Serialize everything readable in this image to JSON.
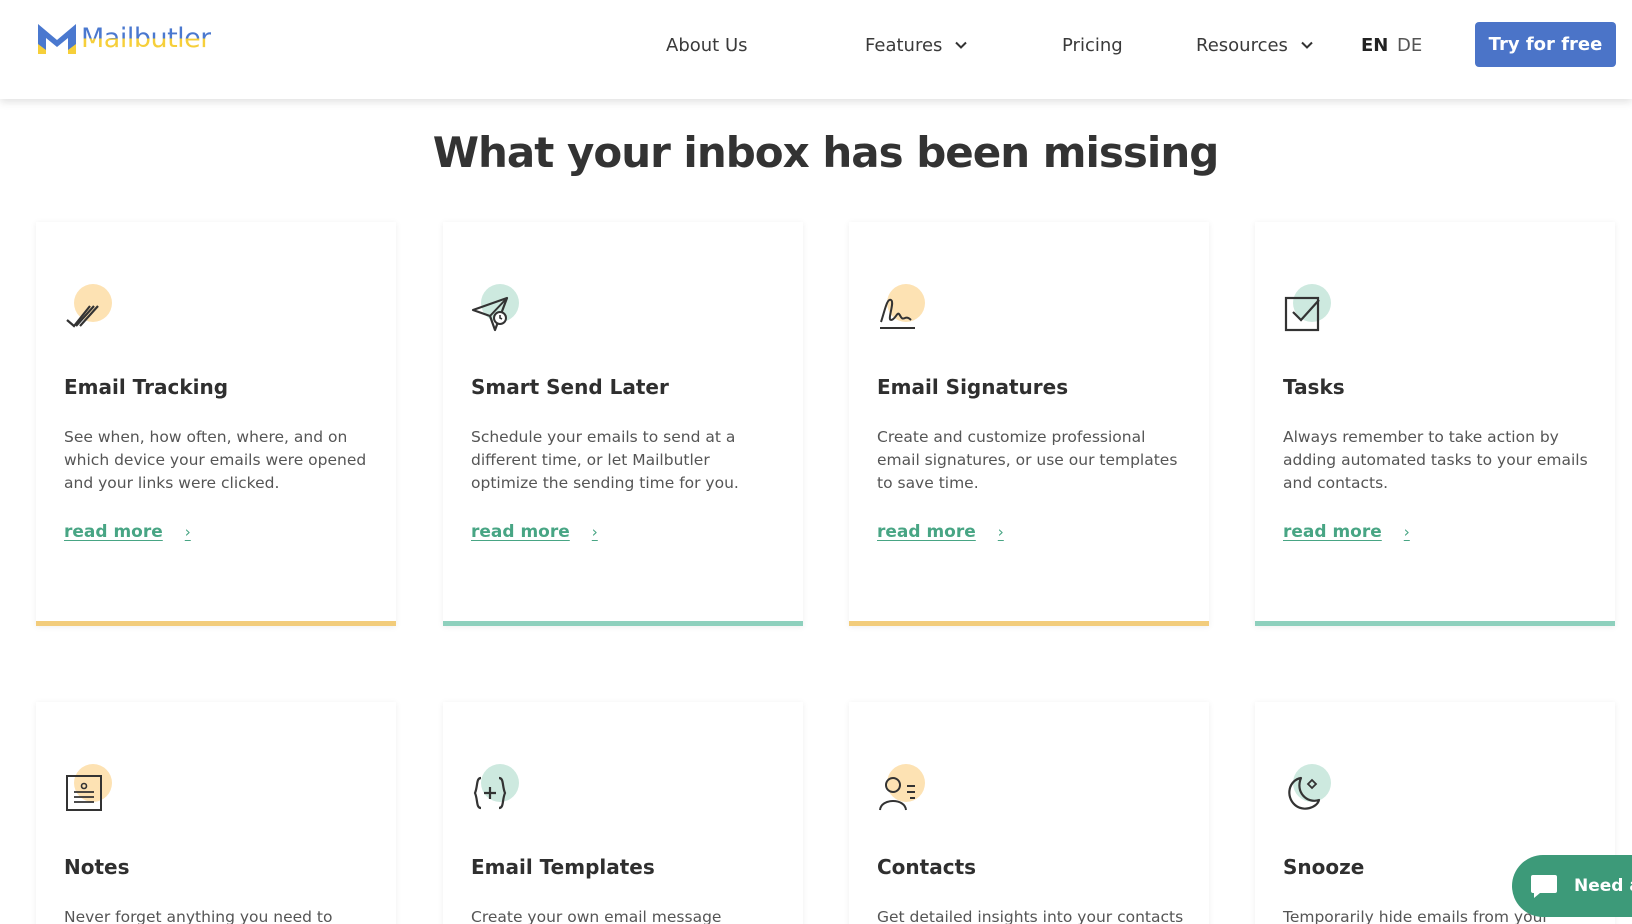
{
  "header": {
    "logo_text": "Mailbutler",
    "nav": [
      {
        "label": "About Us"
      },
      {
        "label": "Features"
      },
      {
        "label": "Pricing"
      },
      {
        "label": "Resources"
      }
    ],
    "languages": {
      "active": "EN",
      "other": "DE"
    },
    "cta_label": "Try for free"
  },
  "section": {
    "title": "What your inbox has been missing"
  },
  "cards": [
    {
      "title": "Email Tracking",
      "description": "See when, how often, where, and on which device your emails were opened and your links were clicked.",
      "link": "read more",
      "icon": "double-check-icon"
    },
    {
      "title": "Smart Send Later",
      "description": "Schedule your emails to send at a different time, or let Mailbutler optimize the sending time for you.",
      "link": "read more",
      "icon": "paper-plane-clock-icon"
    },
    {
      "title": "Email Signatures",
      "description": "Create and customize professional email signatures, or use our templates to save time.",
      "link": "read more",
      "icon": "signature-icon"
    },
    {
      "title": "Tasks",
      "description": "Always remember to take action by adding automated tasks to your emails and contacts.",
      "link": "read more",
      "icon": "checkbox-icon"
    },
    {
      "title": "Notes",
      "description": "Never forget anything you need to",
      "icon": "note-icon"
    },
    {
      "title": "Email Templates",
      "description": "Create your own email message",
      "icon": "braces-plus-icon"
    },
    {
      "title": "Contacts",
      "description": "Get detailed insights into your contacts",
      "icon": "contact-icon"
    },
    {
      "title": "Snooze",
      "description": "Temporarily hide emails from your",
      "icon": "moon-icon"
    }
  ],
  "chat": {
    "label": "Need a"
  },
  "colors": {
    "brand_blue": "#4b74c8",
    "brand_yellow": "#f6cf3a",
    "link_green": "#48a584",
    "accent_yellow": "#f2cc7b",
    "accent_teal": "#8ed0bd",
    "chat_green": "#3d9a79"
  }
}
